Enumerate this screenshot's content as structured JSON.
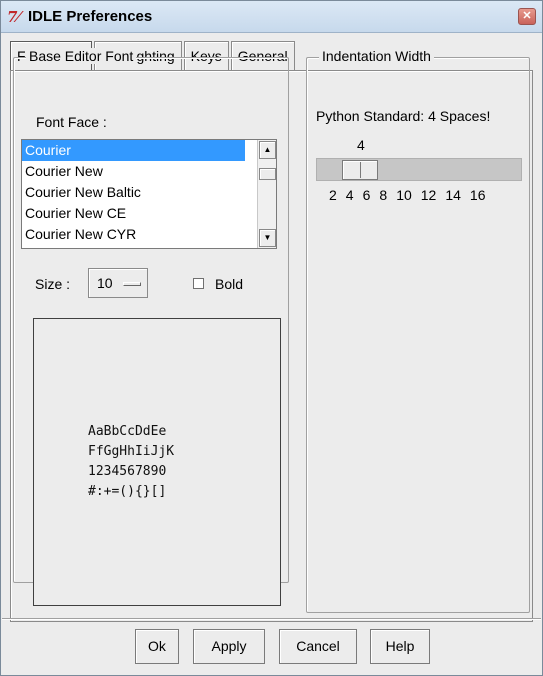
{
  "window": {
    "title": "IDLE Preferences",
    "app_icon": "7⁄",
    "close_label": "✕"
  },
  "tabs": [
    "Fonts/Tabs",
    "Highlighting",
    "Keys",
    "General"
  ],
  "base_font": {
    "group_title": "Base Editor Font",
    "font_face_label": "Font Face :",
    "fonts": [
      "Courier",
      "Courier New",
      "Courier New Baltic",
      "Courier New CE",
      "Courier New CYR"
    ],
    "selected_font": "Courier",
    "size_label": "Size :",
    "size_value": "10",
    "bold_label": "Bold",
    "bold_checked": false,
    "sample_lines": [
      "AaBbCcDdEe",
      "FfGgHhIiJjK",
      "1234567890",
      "#:+=(){}[]"
    ]
  },
  "indentation": {
    "group_title": "Indentation Width",
    "note": "Python Standard: 4 Spaces!",
    "value": "4",
    "ticks": [
      "2",
      "4",
      "6",
      "8",
      "10",
      "12",
      "14",
      "16"
    ]
  },
  "buttons": {
    "ok": "Ok",
    "apply": "Apply",
    "cancel": "Cancel",
    "help": "Help"
  },
  "colors": {
    "selection": "#3399ff",
    "titlebar": "#c7d9ec",
    "icon": "#c0282d"
  }
}
